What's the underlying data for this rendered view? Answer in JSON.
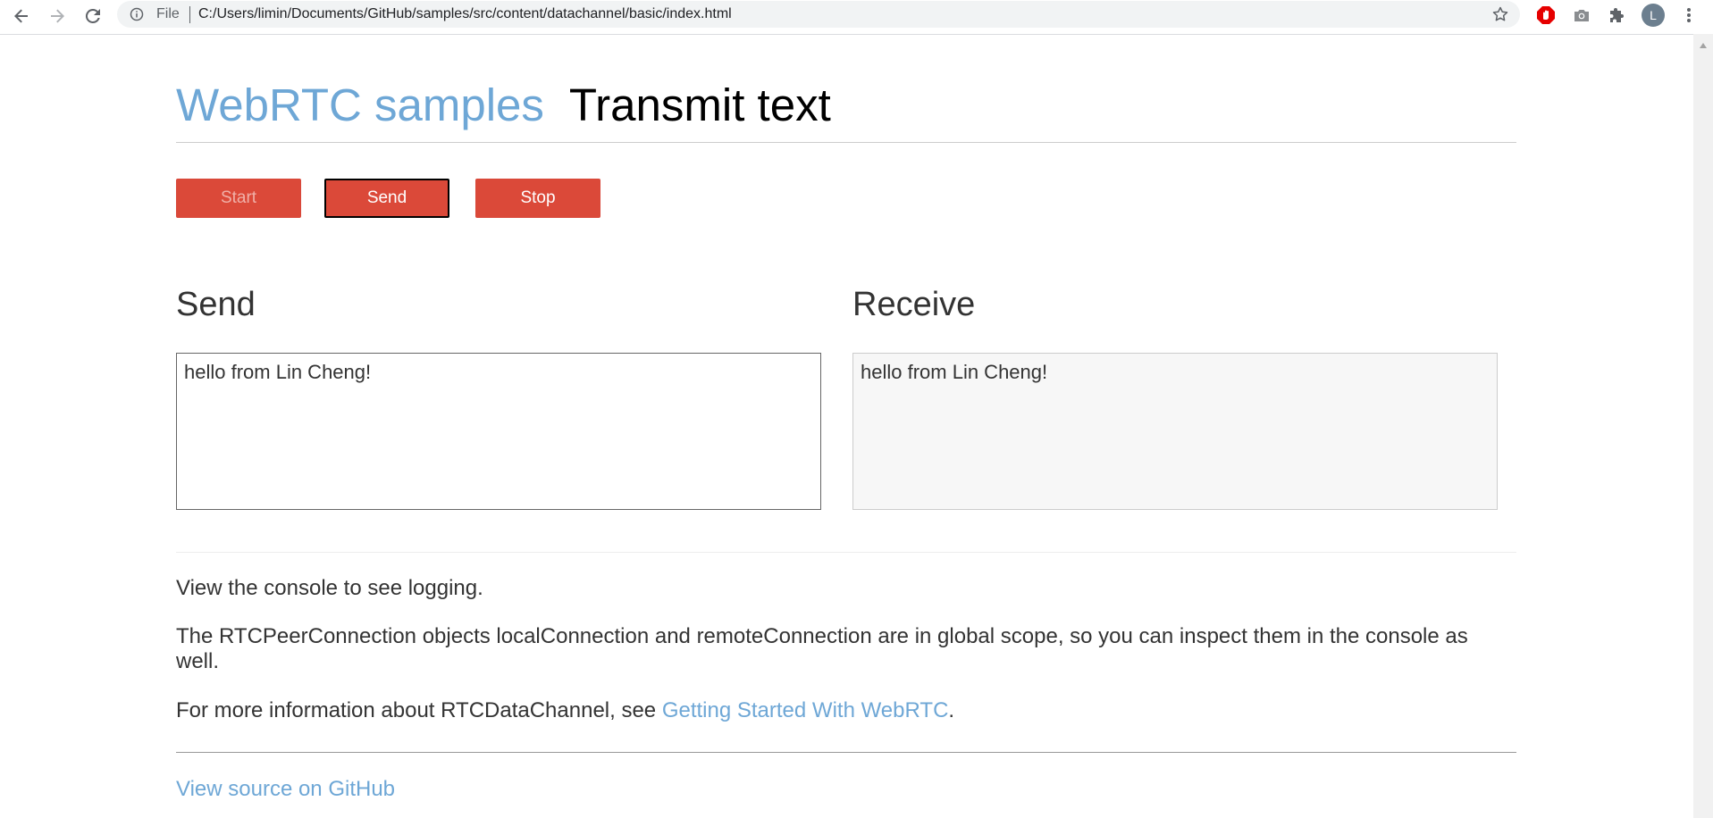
{
  "browser": {
    "omnibox": {
      "scheme_label": "File",
      "url": "C:/Users/limin/Documents/GitHub/samples/src/content/datachannel/basic/index.html"
    },
    "profile_initial": "L"
  },
  "header": {
    "site_link": "WebRTC samples",
    "page_title": "Transmit text"
  },
  "controls": {
    "start_label": "Start",
    "send_label": "Send",
    "stop_label": "Stop"
  },
  "send_panel": {
    "heading": "Send",
    "value": "hello from Lin Cheng!"
  },
  "receive_panel": {
    "heading": "Receive",
    "value": "hello from Lin Cheng!"
  },
  "info": {
    "console_note": "View the console to see logging.",
    "scope_note": "The RTCPeerConnection objects localConnection and remoteConnection are in global scope, so you can inspect them in the console as well.",
    "more_info_prefix": "For more information about RTCDataChannel, see ",
    "more_info_link": "Getting Started With WebRTC",
    "more_info_suffix": "."
  },
  "footer": {
    "github_link": "View source on GitHub"
  },
  "colors": {
    "accent_link": "#6ea7d6",
    "button_red": "#db4939"
  }
}
